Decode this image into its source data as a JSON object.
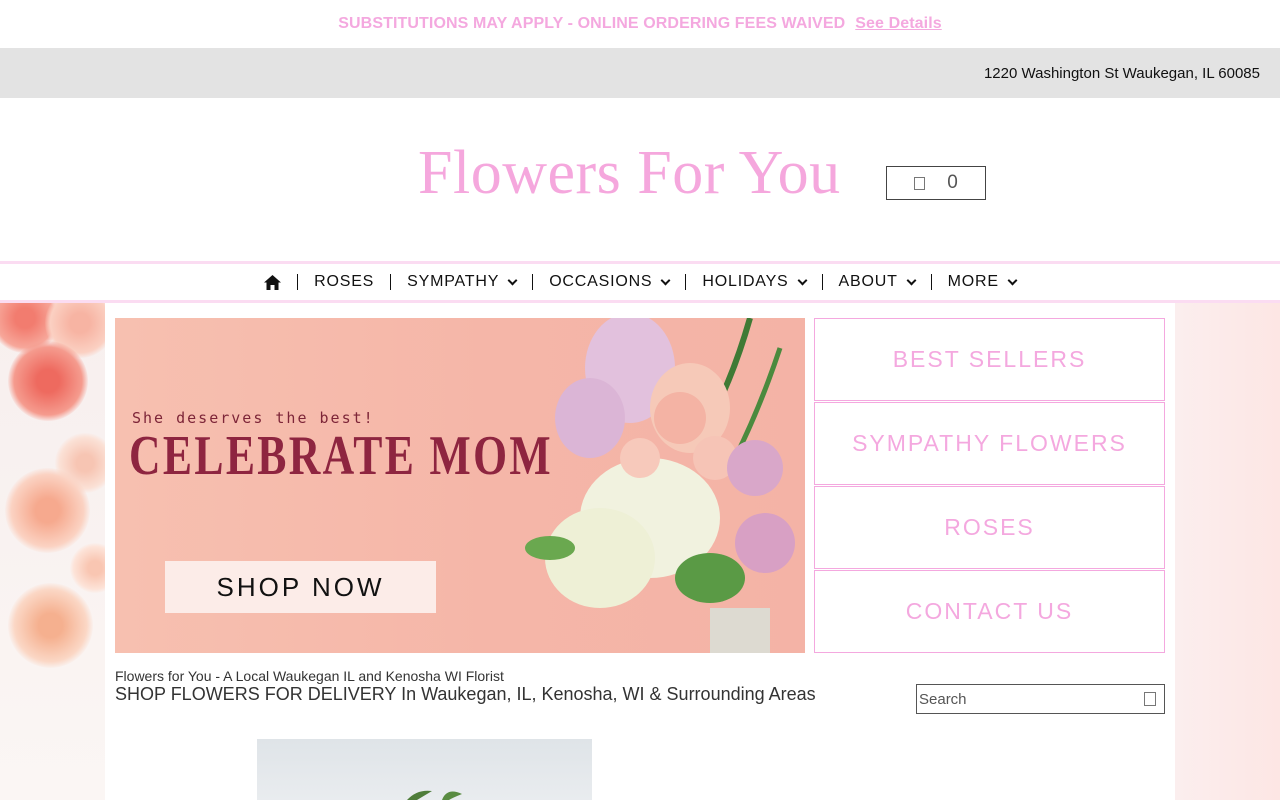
{
  "announcement": {
    "text": "SUBSTITUTIONS MAY APPLY - ONLINE ORDERING FEES WAIVED",
    "link": "See Details"
  },
  "address": "1220 Washington St Waukegan, IL 60085",
  "brand": {
    "logo": "Flowers For You",
    "accent": "#f4a8df"
  },
  "cart": {
    "count": "0",
    "icon": "cart-icon"
  },
  "nav": {
    "home_icon": "home-icon",
    "items": [
      {
        "label": "ROSES",
        "dropdown": false
      },
      {
        "label": "SYMPATHY",
        "dropdown": true
      },
      {
        "label": "OCCASIONS",
        "dropdown": true
      },
      {
        "label": "HOLIDAYS",
        "dropdown": true
      },
      {
        "label": "ABOUT",
        "dropdown": true
      },
      {
        "label": "MORE",
        "dropdown": true
      }
    ]
  },
  "hero": {
    "tagline": "She deserves the best!",
    "headline": "CELEBRATE MOM",
    "cta": "SHOP NOW"
  },
  "categories": [
    "BEST SELLERS",
    "SYMPATHY FLOWERS",
    "ROSES",
    "CONTACT US"
  ],
  "intro": {
    "subtitle": "Flowers for You - A Local Waukegan IL and Kenosha WI Florist",
    "title": "SHOP FLOWERS FOR DELIVERY In Waukegan, IL, Kenosha, WI & Surrounding Areas"
  },
  "search": {
    "placeholder": "Search",
    "icon": "search-icon"
  }
}
